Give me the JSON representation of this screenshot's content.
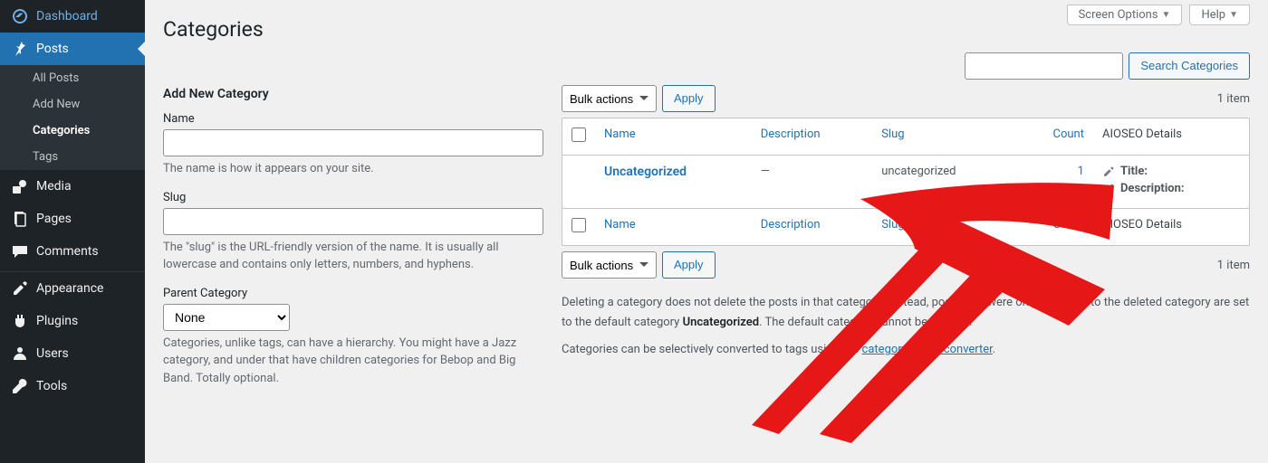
{
  "sidebar": {
    "items": [
      {
        "label": "Dashboard",
        "icon": "dashboard"
      },
      {
        "label": "Posts",
        "icon": "pin",
        "current": true
      },
      {
        "label": "Media",
        "icon": "media"
      },
      {
        "label": "Pages",
        "icon": "pages"
      },
      {
        "label": "Comments",
        "icon": "comments"
      },
      {
        "label": "Appearance",
        "icon": "appearance"
      },
      {
        "label": "Plugins",
        "icon": "plugins"
      },
      {
        "label": "Users",
        "icon": "users"
      },
      {
        "label": "Tools",
        "icon": "tools"
      }
    ],
    "submenu": [
      {
        "label": "All Posts"
      },
      {
        "label": "Add New"
      },
      {
        "label": "Categories",
        "current": true
      },
      {
        "label": "Tags"
      }
    ]
  },
  "header": {
    "screen_options": "Screen Options",
    "help": "Help",
    "page_title": "Categories",
    "search_button": "Search Categories"
  },
  "form": {
    "heading": "Add New Category",
    "name_label": "Name",
    "name_desc": "The name is how it appears on your site.",
    "slug_label": "Slug",
    "slug_desc": "The \"slug\" is the URL-friendly version of the name. It is usually all lowercase and contains only letters, numbers, and hyphens.",
    "parent_label": "Parent Category",
    "parent_value": "None",
    "parent_desc": "Categories, unlike tags, can have a hierarchy. You might have a Jazz category, and under that have children categories for Bebop and Big Band. Totally optional."
  },
  "bulk": {
    "label": "Bulk actions",
    "apply": "Apply"
  },
  "table": {
    "count_text": "1 item",
    "columns": {
      "name": "Name",
      "description": "Description",
      "slug": "Slug",
      "count": "Count",
      "aioseo": "AIOSEO Details"
    },
    "rows": [
      {
        "name": "Uncategorized",
        "description": "—",
        "slug": "uncategorized",
        "count": "1",
        "aioseo_title": "Title:",
        "aioseo_desc": "Description:"
      }
    ]
  },
  "notes": {
    "line1a": "Deleting a category does not delete the posts in that category. Instead, posts that were only assigned to the deleted category are set to the default category ",
    "line1b": "Uncategorized",
    "line1c": ". The default category cannot be deleted.",
    "line2a": "Categories can be selectively converted to tags using the ",
    "line2b": "category to tag converter",
    "line2c": "."
  }
}
